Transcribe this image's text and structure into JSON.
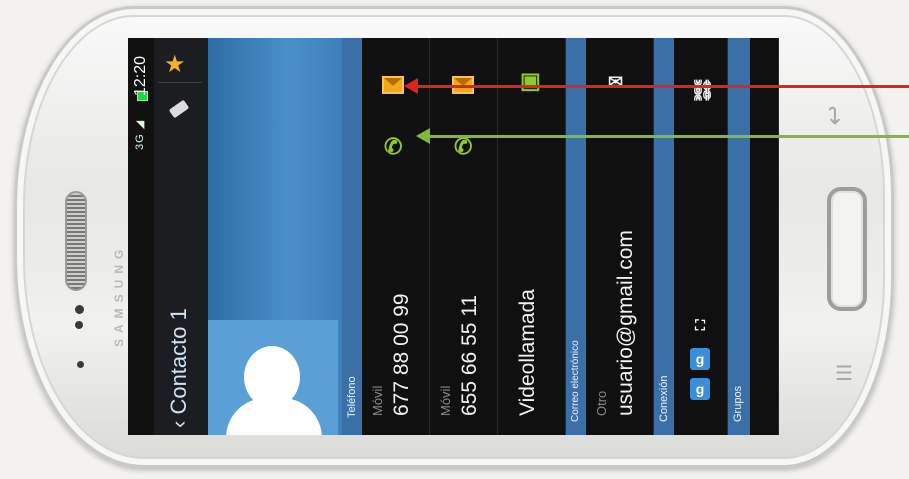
{
  "status_bar": {
    "time": "12:20",
    "icons": "3G ◢"
  },
  "action_bar": {
    "title": "Contacto 1",
    "back_icon": "back-chevron-icon",
    "favorite_icon": "star-icon",
    "edit_icon": "pencil-icon"
  },
  "sections": {
    "phone": "Teléfono",
    "email": "Correo electrónico",
    "connection": "Conexión",
    "groups": "Grupos"
  },
  "phones": [
    {
      "type": "Móvil",
      "number": "677 88 00 99"
    },
    {
      "type": "Móvil",
      "number": "655 66 55 11"
    }
  ],
  "video_call": "Videollamada",
  "email": {
    "type": "Otro",
    "address": "usuario@gmail.com"
  },
  "connections": [
    {
      "name": "Google",
      "glyph": "g",
      "color": "#3a8fd8"
    },
    {
      "name": "Google",
      "glyph": "g",
      "color": "#3a8fd8"
    },
    {
      "name": "Expand",
      "glyph": "⛶",
      "color": "#ffffff"
    }
  ],
  "colors": {
    "accent_blue": "#3b6fa8",
    "message": "#f2a81c",
    "call": "#8fc92e",
    "annotation_red": "#e0231c",
    "annotation_green": "#7fba3a"
  }
}
